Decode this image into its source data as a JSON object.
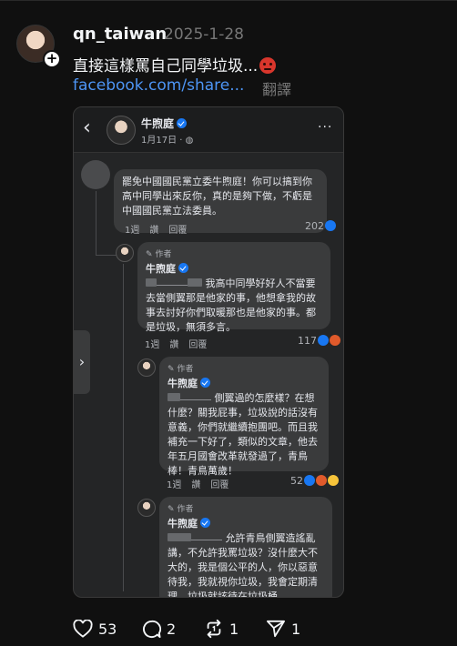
{
  "post": {
    "username": "qn_taiwan",
    "date": "2025-1-28",
    "text": "直接這樣罵自己同學垃圾...",
    "emoji": "angry-face",
    "link": "facebook.com/share...",
    "translate": "翻譯"
  },
  "embed": {
    "back": "‹",
    "page_name": "牛煦庭",
    "page_date": "1月17日 · ◍",
    "more": "···",
    "side_tab": "›",
    "comment1": {
      "text": "罷免中國國民黨立委牛煦庭！你可以搞到你高中同學出來反你，真的是夠下做，不虧是中國國民黨立法委員。",
      "time": "1週",
      "like": "讚",
      "reply": "回覆",
      "count": "202"
    },
    "comment2": {
      "author_tag": "✎ 作者",
      "name": "牛煦庭",
      "text": " 我高中同學好好人不當要去當側翼那是他家的事，他想拿我的故事去討好你們取暖那也是他家的事。都是垃圾，無須多言。",
      "time": "1週",
      "like": "讚",
      "reply": "回覆",
      "count": "117"
    },
    "comment3": {
      "author_tag": "✎ 作者",
      "name": "牛煦庭",
      "text": " 側翼過的怎麼樣？在想什麼？關我屁事，垃圾說的話沒有意義，你們就繼續抱團吧。而且我補充一下好了，類似的文章，他去年五月國會改革就發過了，青鳥棒！青鳥萬歲！",
      "time": "1週",
      "like": "讚",
      "reply": "回覆",
      "count": "52"
    },
    "comment4": {
      "author_tag": "✎ 作者",
      "name": "牛煦庭",
      "text": " 允許青鳥側翼造謠亂講，不允許我罵垃圾？沒什麼大不大的，我是個公平的人，你以惡意待我，我就視你垃圾，我會定期清理，垃圾就該待在垃圾桶"
    }
  },
  "actions": {
    "likes": "53",
    "comments": "2",
    "reposts": "1",
    "shares": "1"
  },
  "colors": {
    "background": "#101010",
    "link": "#4d95f5",
    "muted": "#777777",
    "fb_verified": "#1877f2"
  }
}
